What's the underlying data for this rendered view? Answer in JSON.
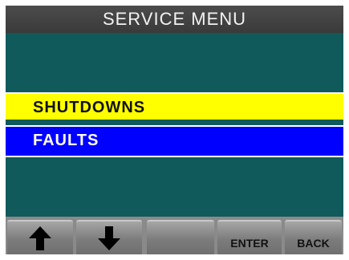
{
  "header": {
    "title": "SERVICE MENU"
  },
  "menu": {
    "items": [
      {
        "label": "SHUTDOWNS",
        "selected": true
      },
      {
        "label": "FAULTS",
        "selected": false
      }
    ]
  },
  "toolbar": {
    "up_icon": "up-arrow-icon",
    "down_icon": "down-arrow-icon",
    "blank_label": "",
    "enter_label": "ENTER",
    "back_label": "BACK"
  },
  "colors": {
    "screen_bg": "#105a5b",
    "title_bar": "#444444",
    "selected_item": "#ffff00",
    "item_bg": "#0000ff"
  }
}
